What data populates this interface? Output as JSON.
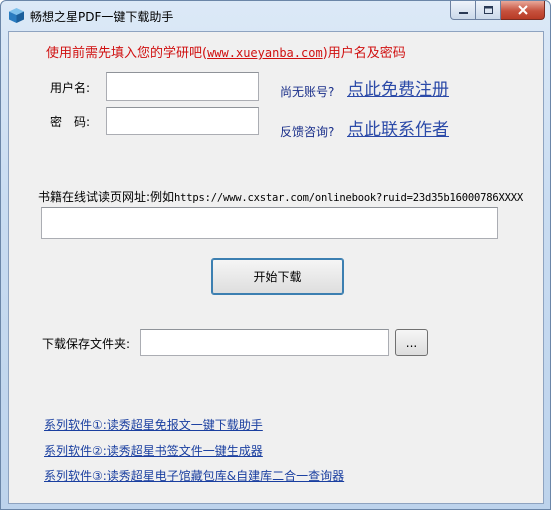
{
  "window": {
    "title": "畅想之星PDF一键下载助手"
  },
  "notice": {
    "prefix": "使用前需先填入您的学研吧(",
    "link": "www.xueyanba.com",
    "suffix": ")用户名及密码"
  },
  "login": {
    "username_label": "用户名:",
    "password_label": "密　码:",
    "username_value": "",
    "password_value": ""
  },
  "register": {
    "hint": "尚无账号?",
    "link": "点此免费注册"
  },
  "feedback": {
    "hint": "反馈咨询?",
    "link": "点此联系作者"
  },
  "url": {
    "label": "书籍在线试读页网址:例如",
    "example": "https://www.cxstar.com/onlinebook?ruid=23d35b16000786XXXX",
    "value": ""
  },
  "start_button": "开始下载",
  "save": {
    "label": "下载保存文件夹:",
    "value": "",
    "browse_button": "..."
  },
  "series": [
    "系列软件①:读秀超星免报文一键下载助手",
    "系列软件②:读秀超星书签文件一键生成器",
    "系列软件③:读秀超星电子馆藏包库&自建库二合一查询器"
  ],
  "colors": {
    "notice": "#d01010",
    "link_blue": "#2b4aa8",
    "hint_blue": "#1a2f8a"
  }
}
